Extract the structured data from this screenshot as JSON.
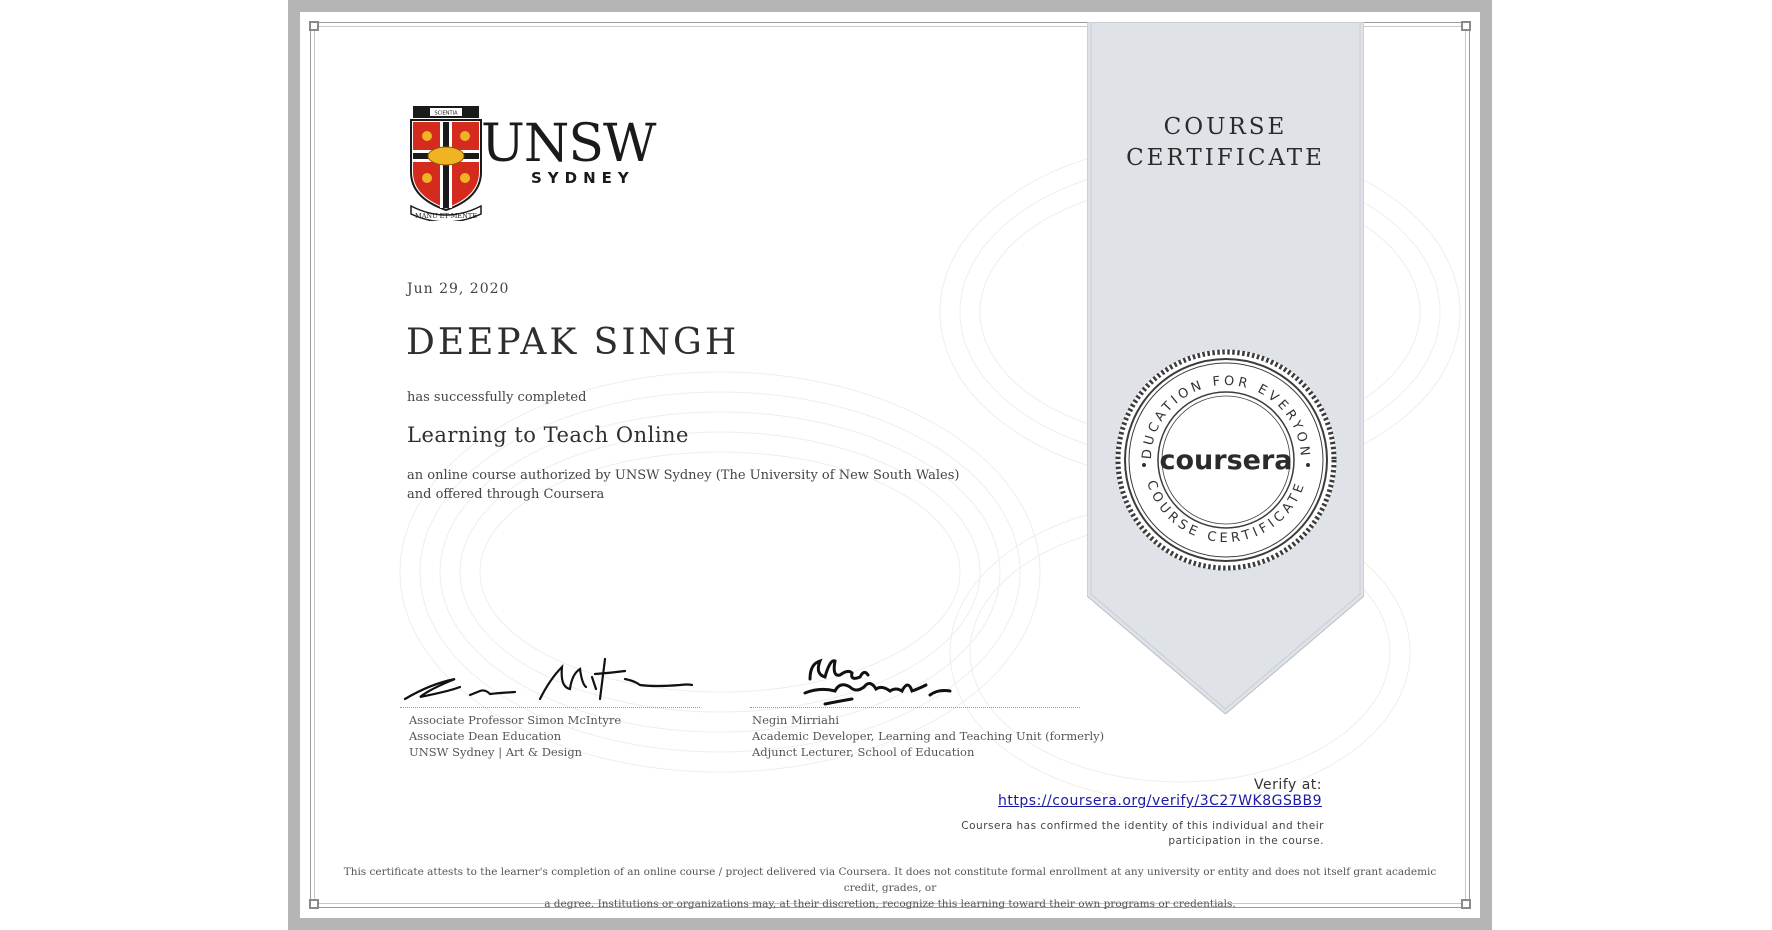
{
  "header": {
    "institution_name": "UNSW",
    "institution_location": "SYDNEY",
    "crest_banner_text": "SCIENTIA",
    "crest_motto": "MANU ET MENTE"
  },
  "ribbon": {
    "title_line1": "COURSE",
    "title_line2": "CERTIFICATE"
  },
  "seal": {
    "top_arc_text": "EDUCATION FOR EVERYONE",
    "bottom_arc_text": "COURSE CERTIFICATE",
    "brand": "coursera"
  },
  "certificate": {
    "date": "Jun 29, 2020",
    "recipient_name": "DEEPAK SINGH",
    "completed_text": "has successfully completed",
    "course_name": "Learning to Teach Online",
    "course_description": "an online course authorized by UNSW Sydney (The University of New South Wales) and offered through Coursera"
  },
  "signatures": [
    {
      "name": "Associate Professor Simon McIntyre",
      "line2": "Associate Dean Education",
      "line3": "UNSW Sydney | Art & Design"
    },
    {
      "name": "Negin Mirriahi",
      "line2": "Academic Developer, Learning and Teaching Unit (formerly)",
      "line3": "Adjunct Lecturer, School of Education"
    }
  ],
  "verification": {
    "label": "Verify at:",
    "url": "https://coursera.org/verify/3C27WK8GSBB9",
    "identity_line1": "Coursera has confirmed the identity of this individual and their",
    "identity_line2": "participation in the course."
  },
  "footer": {
    "line1": "This certificate attests to the learner's completion of an online course / project delivered via Coursera. It does not constitute formal enrollment at any university or entity and does not itself grant academic credit, grades, or",
    "line2": "a degree. Institutions or organizations may, at their discretion, recognize this learning toward their own programs or credentials."
  },
  "colors": {
    "frame": "#b5b5b5",
    "ribbon": "#dfe3e8",
    "crest_red": "#d52b1e",
    "crest_gold": "#f0b323",
    "link": "#1a1aa6"
  }
}
